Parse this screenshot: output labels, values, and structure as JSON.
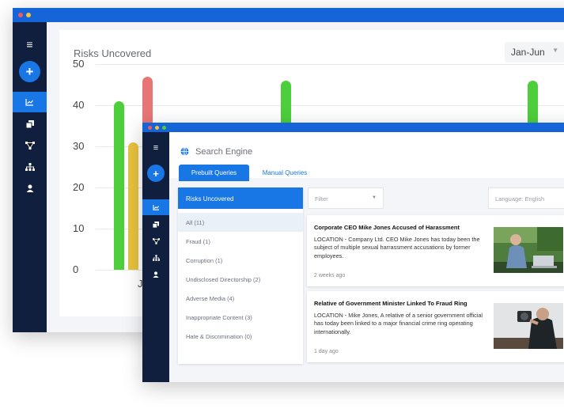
{
  "dashboard": {
    "chart_title": "Risks Uncovered",
    "range": "Jan-Jun",
    "sidebar": {
      "plus_label": "+",
      "icons": [
        "menu-icon",
        "chart-icon",
        "copy-icon",
        "network-icon",
        "sitemap-icon",
        "user-icon"
      ]
    }
  },
  "chart_data": {
    "type": "bar",
    "title": "Risks Uncovered",
    "ylim": [
      0,
      50
    ],
    "yticks": [
      0,
      10,
      20,
      30,
      40,
      50
    ],
    "categories": [
      "Jan"
    ],
    "grid": true,
    "colors": [
      "#4ccf3a",
      "#e8c23e",
      "#e87575"
    ],
    "series_values": [
      41,
      31,
      47
    ],
    "partial_bars": [
      46,
      46
    ]
  },
  "search": {
    "title": "Search Engine",
    "tabs": [
      "Prebuilt Queries",
      "Manual Queries"
    ],
    "panel_header": "Risks Uncovered",
    "categories": [
      "All (11)",
      "Fraud (1)",
      "Corruption (1)",
      "Undisclosed Directorship (2)",
      "Adverse Media (4)",
      "Inappropriate Content (3)",
      "Hate & Discrimination (0)"
    ],
    "filter_placeholder": "Filter",
    "language": "Language: English",
    "results": [
      {
        "title": "Corporate CEO Mike Jones Accused of Harassment",
        "body": "LOCATION - Company Ltd. CEO Mike Jones has today been the subject of multiple sexual harrassment accusations by former employees.",
        "time": "2 weeks ago"
      },
      {
        "title": "Relative of Government Minister Linked To Fraud Ring",
        "body": "LOCATION - Mike Jones, A relative of a senior government official has today been linked to a major financial crime ring operating internationally.",
        "time": "1 day ago"
      }
    ]
  }
}
